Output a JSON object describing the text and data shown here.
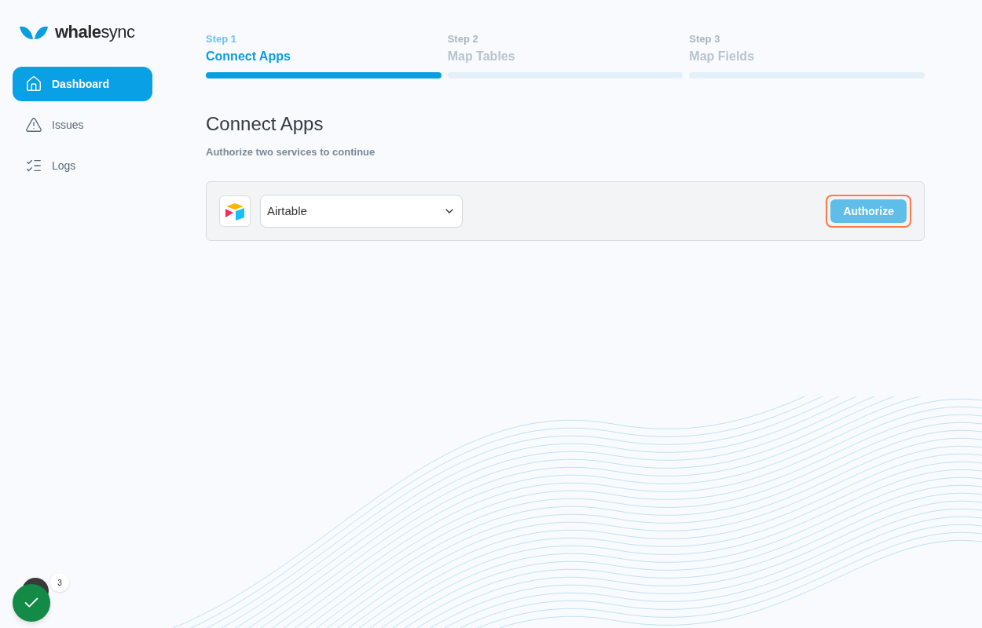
{
  "logo": {
    "text": "**whale**sync"
  },
  "sidebar": {
    "items": [
      {
        "label": "Dashboard",
        "kind": "home",
        "selected": true
      },
      {
        "label": "Issues",
        "kind": "warning",
        "selected": false
      },
      {
        "label": "Logs",
        "kind": "checklist",
        "selected": false
      }
    ]
  },
  "steps": [
    {
      "step": "Step 1",
      "label": "Connect Apps",
      "selected": true
    },
    {
      "step": "Step 2",
      "label": "Map Tables",
      "selected": false
    },
    {
      "step": "Step 3",
      "label": "Map Fields",
      "selected": false
    }
  ],
  "heading": "Connect Apps",
  "subheading": "Authorize two services to continue",
  "connector": {
    "app": "Airtable",
    "button": {
      "label": "Authorize",
      "highlighted": true
    }
  },
  "status_badge": {
    "count": "3"
  }
}
